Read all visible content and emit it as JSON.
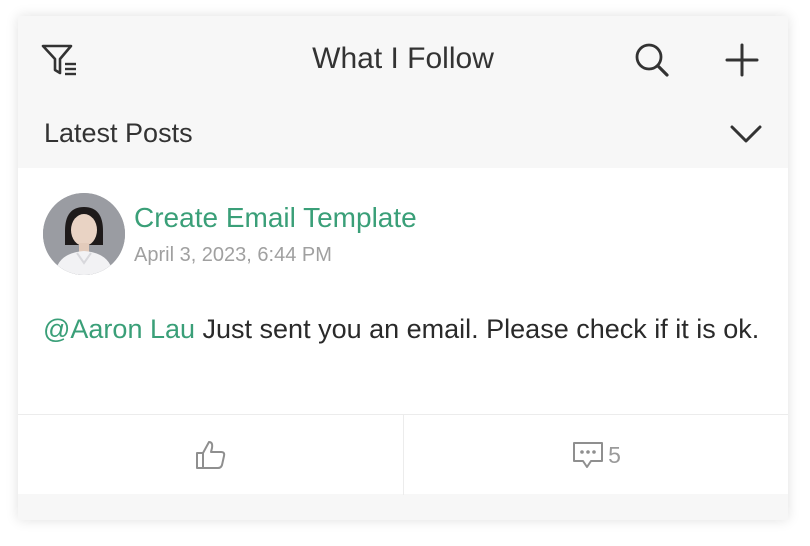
{
  "header": {
    "title": "What I Follow",
    "filter_icon": "filter-list-icon",
    "search_icon": "search-icon",
    "add_icon": "plus-icon"
  },
  "subheader": {
    "label": "Latest Posts",
    "chevron_icon": "chevron-down-icon"
  },
  "post": {
    "title": "Create Email Template",
    "timestamp": "April 3, 2023, 6:44 PM",
    "mention": "@Aaron Lau",
    "body": " Just sent you an email. Please check if it is ok.",
    "like_icon": "thumbs-up-icon",
    "comment_icon": "comment-icon",
    "comment_count": "5"
  },
  "colors": {
    "accent": "#3a9f78",
    "muted": "#a0a0a0",
    "header_bg": "#f7f7f7"
  }
}
